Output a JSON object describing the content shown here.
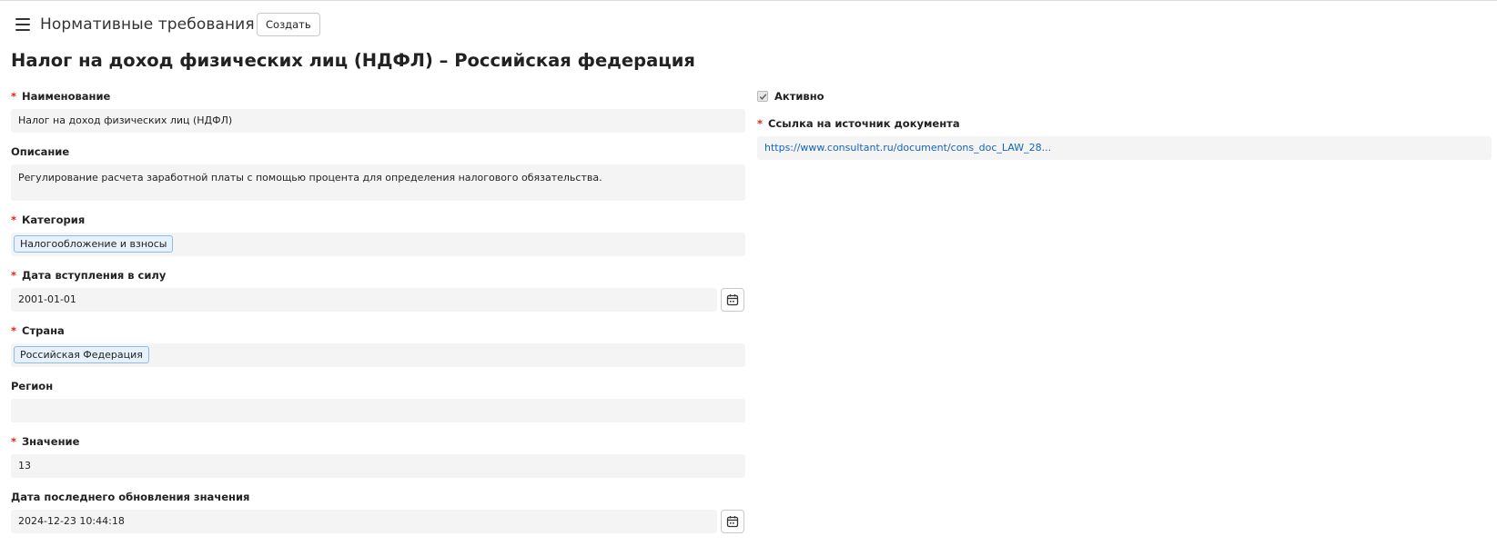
{
  "header": {
    "app_title": "Нормативные требования",
    "create_label": "Создать"
  },
  "page": {
    "title": "Налог на доход физических лиц (НДФЛ) – Российская федерация"
  },
  "form": {
    "name": {
      "label": "Наименование",
      "required": "*",
      "value": "Налог на доход физических лиц (НДФЛ)"
    },
    "description": {
      "label": "Описание",
      "value": "Регулирование расчета заработной платы с помощью процента для определения налогового обязательства."
    },
    "category": {
      "label": "Категория",
      "required": "*",
      "tag": "Налогообложение и взносы"
    },
    "effective_date": {
      "label": "Дата вступления в силу",
      "required": "*",
      "value": "2001-01-01"
    },
    "country": {
      "label": "Страна",
      "required": "*",
      "tag": "Российская Федерация"
    },
    "region": {
      "label": "Регион",
      "value": ""
    },
    "value": {
      "label": "Значение",
      "required": "*",
      "value": "13"
    },
    "value_updated": {
      "label": "Дата последнего обновления значения",
      "value": "2024-12-23 10:44:18"
    },
    "active": {
      "label": "Активно",
      "checked": true
    },
    "source_link": {
      "label": "Ссылка на источник документа",
      "required": "*",
      "value": "https://www.consultant.ru/document/cons_doc_LAW_28..."
    }
  },
  "colors": {
    "required": "#d9261c",
    "link": "#1565b8",
    "tag_bg": "#e6f1fb",
    "tag_border": "#8cbde6",
    "field_bg": "#f4f4f4"
  },
  "icons": {
    "menu": "hamburger-menu-icon",
    "calendar": "calendar-icon",
    "check": "checkmark-icon"
  }
}
